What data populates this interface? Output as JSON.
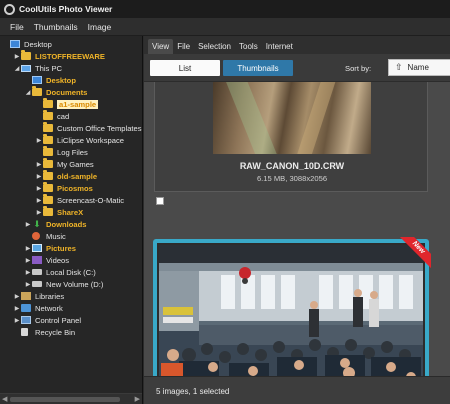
{
  "app": {
    "title": "CoolUtils Photo Viewer"
  },
  "menu": [
    "File",
    "Thumbnails",
    "Image"
  ],
  "tree": [
    {
      "label": "Desktop",
      "indent": 0,
      "arrow": "",
      "icon": "desktop"
    },
    {
      "label": "LISTOFFREEWARE",
      "indent": 1,
      "arrow": "▶",
      "icon": "folder",
      "style": "gold"
    },
    {
      "label": "This PC",
      "indent": 1,
      "arrow": "◢",
      "icon": "pc"
    },
    {
      "label": "Desktop",
      "indent": 2,
      "arrow": "",
      "icon": "desktop",
      "style": "gold"
    },
    {
      "label": "Documents",
      "indent": 2,
      "arrow": "◢",
      "icon": "folder",
      "style": "gold"
    },
    {
      "label": "a1-sample",
      "indent": 3,
      "arrow": "",
      "icon": "folder",
      "style": "selected"
    },
    {
      "label": "cad",
      "indent": 3,
      "arrow": "",
      "icon": "folder"
    },
    {
      "label": "Custom Office Templates",
      "indent": 3,
      "arrow": "",
      "icon": "folder"
    },
    {
      "label": "LiClipse Workspace",
      "indent": 3,
      "arrow": "▶",
      "icon": "folder"
    },
    {
      "label": "Log Files",
      "indent": 3,
      "arrow": "",
      "icon": "folder"
    },
    {
      "label": "My Games",
      "indent": 3,
      "arrow": "▶",
      "icon": "folder"
    },
    {
      "label": "old-sample",
      "indent": 3,
      "arrow": "▶",
      "icon": "folder",
      "style": "gold"
    },
    {
      "label": "Picosmos",
      "indent": 3,
      "arrow": "▶",
      "icon": "folder",
      "style": "gold"
    },
    {
      "label": "Screencast-O-Matic",
      "indent": 3,
      "arrow": "▶",
      "icon": "folder"
    },
    {
      "label": "ShareX",
      "indent": 3,
      "arrow": "▶",
      "icon": "folder",
      "style": "gold"
    },
    {
      "label": "Downloads",
      "indent": 2,
      "arrow": "▶",
      "icon": "download",
      "style": "gold"
    },
    {
      "label": "Music",
      "indent": 2,
      "arrow": "",
      "icon": "music"
    },
    {
      "label": "Pictures",
      "indent": 2,
      "arrow": "▶",
      "icon": "pictures",
      "style": "gold"
    },
    {
      "label": "Videos",
      "indent": 2,
      "arrow": "▶",
      "icon": "videos"
    },
    {
      "label": "Local Disk (C:)",
      "indent": 2,
      "arrow": "▶",
      "icon": "disk"
    },
    {
      "label": "New Volume (D:)",
      "indent": 2,
      "arrow": "▶",
      "icon": "disk"
    },
    {
      "label": "Libraries",
      "indent": 1,
      "arrow": "▶",
      "icon": "libico"
    },
    {
      "label": "Network",
      "indent": 1,
      "arrow": "▶",
      "icon": "netico"
    },
    {
      "label": "Control Panel",
      "indent": 1,
      "arrow": "▶",
      "icon": "cpico"
    },
    {
      "label": "Recycle Bin",
      "indent": 1,
      "arrow": "",
      "icon": "binico"
    }
  ],
  "tabs": [
    "View",
    "File",
    "Selection",
    "Tools",
    "Internet"
  ],
  "toolbar": {
    "list_label": "List",
    "thumbs_label": "Thumbnails",
    "sort_label": "Sort by:",
    "sort_value": "Name"
  },
  "images": [
    {
      "name": "RAW_CANON_10D.CRW",
      "meta": "6.15 MB, 3088x2056"
    },
    {
      "badge": "New"
    }
  ],
  "status": {
    "text": "5 images, 1 selected"
  },
  "colors": {
    "accent": "#2f78a8",
    "selection_border": "#39a9c8",
    "gold": "#f0b428",
    "badge": "#e0262c"
  }
}
